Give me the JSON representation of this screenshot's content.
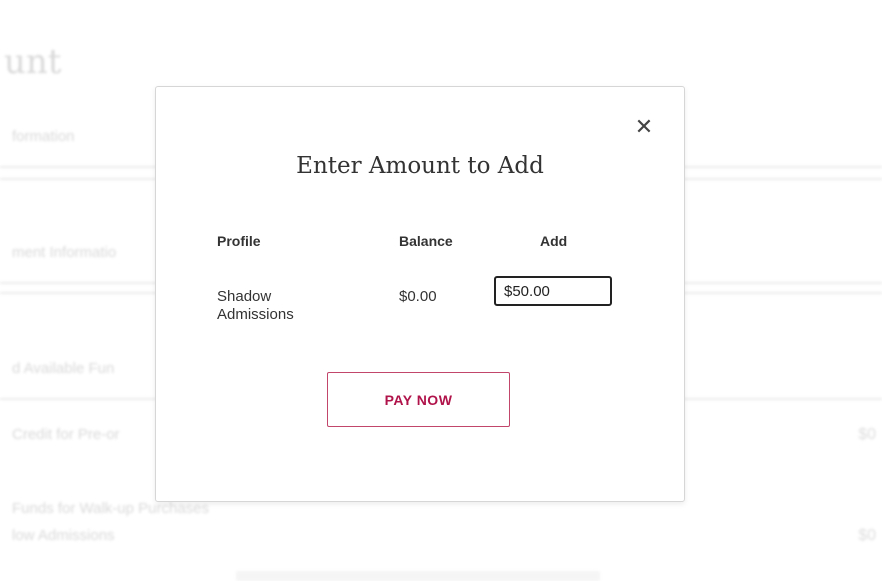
{
  "background": {
    "title": "unt",
    "rows": [
      "formation",
      "ment Informatio",
      "d Available Fun",
      "Credit for Pre-or",
      "Funds for Walk-up Purchases",
      "low Admissions"
    ],
    "amounts": [
      "$0",
      "$0"
    ]
  },
  "modal": {
    "title": "Enter Amount to Add",
    "close_icon": "close-icon",
    "headers": {
      "profile": "Profile",
      "balance": "Balance",
      "add": "Add"
    },
    "rows": [
      {
        "profile": "Shadow Admissions",
        "balance": "$0.00",
        "add_value": "$50.00"
      }
    ],
    "pay_button_label": "PAY NOW"
  },
  "colors": {
    "accent": "#b0134a",
    "accent_border": "#c2456b"
  }
}
